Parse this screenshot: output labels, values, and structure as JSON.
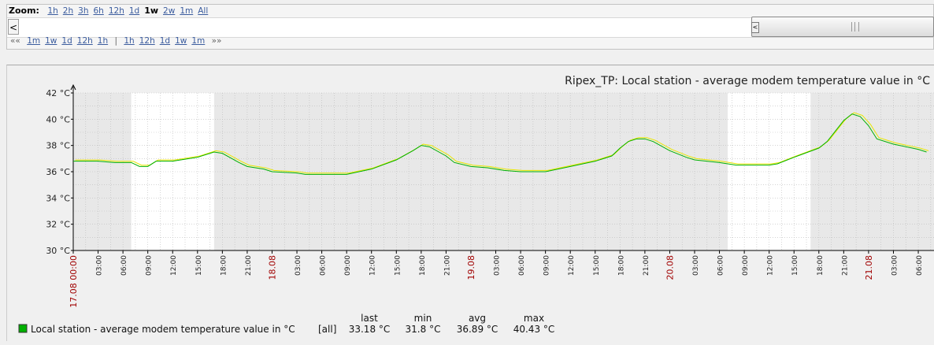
{
  "zoom": {
    "label": "Zoom:",
    "options": [
      "1h",
      "2h",
      "3h",
      "6h",
      "12h",
      "1d",
      "1w",
      "2w",
      "1m",
      "All"
    ],
    "selected": "1w"
  },
  "scrollbar": {
    "left_arrow": "<",
    "handle_glyph": "<"
  },
  "navigation": {
    "back_marker": "««",
    "back": [
      "1m",
      "1w",
      "1d",
      "12h",
      "1h"
    ],
    "separator": "|",
    "forward": [
      "1h",
      "12h",
      "1d",
      "1w",
      "1m"
    ],
    "forward_marker": "»»"
  },
  "graph": {
    "title": "Ripex_TP: Local station - average modem temperature value in °C",
    "colors": {
      "plot_bg": "#e8e8e8",
      "workhours_bg": "#ffffff",
      "line": "#00b000",
      "line_minmax": "#e8e800",
      "date_label": "#a00000",
      "grid": "#bbbbbb"
    }
  },
  "chart_data": {
    "type": "line",
    "title": "Ripex_TP: Local station - average modem temperature value in °C",
    "ylabel": "°C",
    "xlabel": "",
    "ylim": [
      30,
      42
    ],
    "y_ticks": [
      "30 °C",
      "32 °C",
      "34 °C",
      "36 °C",
      "38 °C",
      "40 °C",
      "42 °C"
    ],
    "x_range_hours": [
      0,
      130
    ],
    "x_tick_labels": [
      {
        "hour": 0,
        "label": "17.08 00:00",
        "date": true
      },
      {
        "hour": 3,
        "label": "03:00"
      },
      {
        "hour": 6,
        "label": "06:00"
      },
      {
        "hour": 9,
        "label": "09:00"
      },
      {
        "hour": 12,
        "label": "12:00"
      },
      {
        "hour": 15,
        "label": "15:00"
      },
      {
        "hour": 18,
        "label": "18:00"
      },
      {
        "hour": 21,
        "label": "21:00"
      },
      {
        "hour": 24,
        "label": "18.08",
        "date": true
      },
      {
        "hour": 27,
        "label": "03:00"
      },
      {
        "hour": 30,
        "label": "06:00"
      },
      {
        "hour": 33,
        "label": "09:00"
      },
      {
        "hour": 36,
        "label": "12:00"
      },
      {
        "hour": 39,
        "label": "15:00"
      },
      {
        "hour": 42,
        "label": "18:00"
      },
      {
        "hour": 45,
        "label": "21:00"
      },
      {
        "hour": 48,
        "label": "19.08",
        "date": true
      },
      {
        "hour": 51,
        "label": "03:00"
      },
      {
        "hour": 54,
        "label": "06:00"
      },
      {
        "hour": 57,
        "label": "09:00"
      },
      {
        "hour": 60,
        "label": "12:00"
      },
      {
        "hour": 63,
        "label": "15:00"
      },
      {
        "hour": 66,
        "label": "18:00"
      },
      {
        "hour": 69,
        "label": "21:00"
      },
      {
        "hour": 72,
        "label": "20.08",
        "date": true
      },
      {
        "hour": 75,
        "label": "03:00"
      },
      {
        "hour": 78,
        "label": "06:00"
      },
      {
        "hour": 81,
        "label": "09:00"
      },
      {
        "hour": 84,
        "label": "12:00"
      },
      {
        "hour": 87,
        "label": "15:00"
      },
      {
        "hour": 90,
        "label": "18:00"
      },
      {
        "hour": 93,
        "label": "21:00"
      },
      {
        "hour": 96,
        "label": "21.08",
        "date": true
      },
      {
        "hour": 99,
        "label": "03:00"
      },
      {
        "hour": 102,
        "label": "06:00"
      }
    ],
    "work_hours": [
      [
        7,
        17
      ],
      [
        79,
        89
      ]
    ],
    "grid": true,
    "series": [
      {
        "name": "Local station - average modem temperature value in °C",
        "color": "#00b000",
        "points": [
          [
            0,
            36.8
          ],
          [
            3,
            36.8
          ],
          [
            5,
            36.7
          ],
          [
            7,
            36.7
          ],
          [
            8,
            36.4
          ],
          [
            9,
            36.4
          ],
          [
            10,
            36.8
          ],
          [
            12,
            36.8
          ],
          [
            15,
            37.1
          ],
          [
            17,
            37.5
          ],
          [
            18,
            37.4
          ],
          [
            20,
            36.7
          ],
          [
            21,
            36.4
          ],
          [
            23,
            36.2
          ],
          [
            24,
            36.0
          ],
          [
            27,
            35.9
          ],
          [
            28,
            35.8
          ],
          [
            30,
            35.8
          ],
          [
            33,
            35.8
          ],
          [
            36,
            36.2
          ],
          [
            39,
            36.9
          ],
          [
            41,
            37.6
          ],
          [
            42,
            38.0
          ],
          [
            43,
            37.9
          ],
          [
            45,
            37.2
          ],
          [
            46,
            36.7
          ],
          [
            48,
            36.4
          ],
          [
            50,
            36.3
          ],
          [
            52,
            36.1
          ],
          [
            54,
            36.0
          ],
          [
            57,
            36.0
          ],
          [
            60,
            36.4
          ],
          [
            63,
            36.8
          ],
          [
            65,
            37.2
          ],
          [
            66,
            37.8
          ],
          [
            67,
            38.3
          ],
          [
            68,
            38.5
          ],
          [
            69,
            38.5
          ],
          [
            70,
            38.3
          ],
          [
            72,
            37.6
          ],
          [
            74,
            37.1
          ],
          [
            75,
            36.9
          ],
          [
            78,
            36.7
          ],
          [
            80,
            36.5
          ],
          [
            84,
            36.5
          ],
          [
            85,
            36.6
          ],
          [
            87,
            37.1
          ],
          [
            90,
            37.8
          ],
          [
            91,
            38.3
          ],
          [
            92,
            39.1
          ],
          [
            93,
            39.9
          ],
          [
            94,
            40.4
          ],
          [
            95,
            40.2
          ],
          [
            96,
            39.5
          ],
          [
            97,
            38.5
          ],
          [
            99,
            38.1
          ],
          [
            102,
            37.7
          ],
          [
            103,
            37.5
          ],
          [
            107,
            37.4
          ]
        ]
      }
    ],
    "legend": {
      "series_label": "Local station - average modem temperature value in °C",
      "function": "[all]",
      "headers": [
        "last",
        "min",
        "avg",
        "max"
      ],
      "values": [
        "33.18 °C",
        "31.8 °C",
        "36.89 °C",
        "40.43 °C"
      ]
    }
  }
}
